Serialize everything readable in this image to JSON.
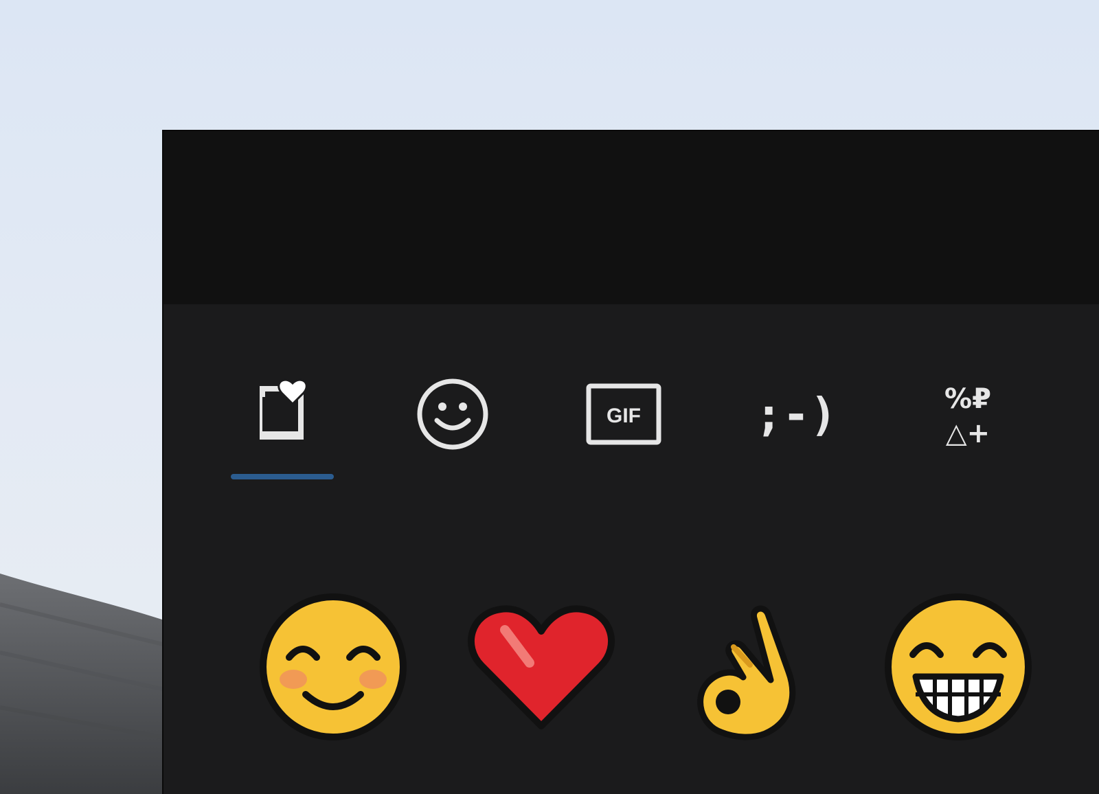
{
  "emoji_panel": {
    "tabs": [
      {
        "id": "recent",
        "icon": "recently-used-icon",
        "selected": true
      },
      {
        "id": "emoji",
        "icon": "smiley-icon",
        "selected": false
      },
      {
        "id": "gif",
        "icon": "gif-icon",
        "label": "GIF",
        "selected": false
      },
      {
        "id": "kaomoji",
        "icon": "kaomoji-icon",
        "label": ";-)",
        "selected": false
      },
      {
        "id": "symbols",
        "icon": "symbols-icon",
        "label_top": "%₽",
        "label_bottom": "△+",
        "selected": false
      }
    ],
    "recent_emojis": [
      {
        "name": "smiling-face-with-smiling-eyes",
        "char": "😊"
      },
      {
        "name": "red-heart",
        "char": "❤️"
      },
      {
        "name": "ok-hand",
        "char": "👌"
      },
      {
        "name": "grinning-face-with-smiling-eyes",
        "char": "😁"
      }
    ]
  },
  "colors": {
    "panel_background": "#1b1b1c",
    "panel_header": "#111111",
    "tab_icon": "#e6e6e6",
    "selected_indicator": "#2b5c8f",
    "emoji_yellow": "#f6c235",
    "heart_red": "#e0242c"
  }
}
